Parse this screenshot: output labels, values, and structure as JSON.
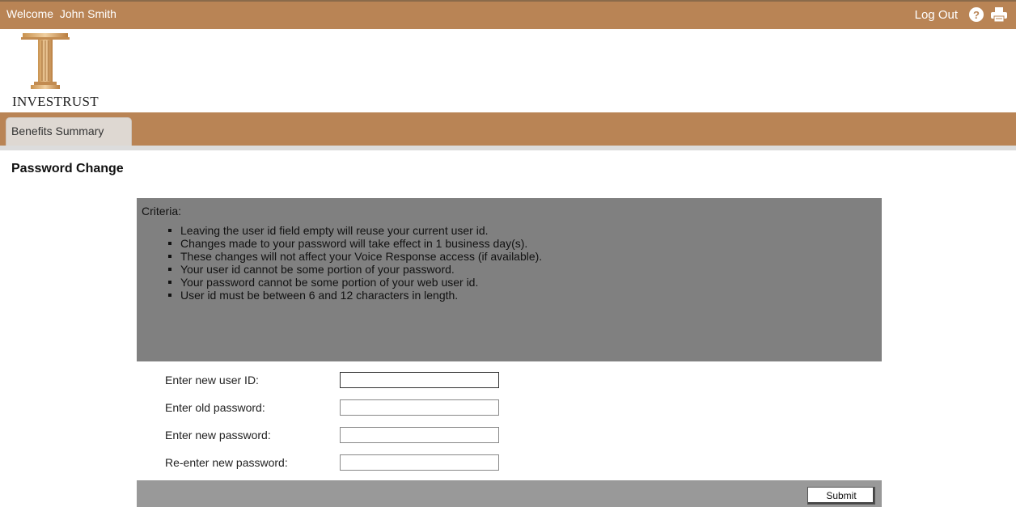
{
  "header": {
    "welcome": "Welcome  John Smith",
    "logout_label": "Log Out",
    "help_icon": "help-icon",
    "print_icon": "print-icon"
  },
  "brand": {
    "name": "INVESTRUST",
    "colors": {
      "header": "#b98455",
      "panel": "#808080",
      "footer": "#999999"
    }
  },
  "nav": {
    "tabs": [
      {
        "label": "Benefits Summary"
      }
    ]
  },
  "page": {
    "title": "Password Change"
  },
  "criteria": {
    "title": "Criteria:",
    "items": [
      "Leaving the user id field empty will reuse your current user id.",
      "Changes made to your password will take effect in 1 business day(s).",
      "These changes will not affect your Voice Response access (if available).",
      "Your user id cannot be some portion of your password.",
      "Your password cannot be some portion of your web user id.",
      "User id must be between 6 and 12 characters in length."
    ]
  },
  "form": {
    "fields": [
      {
        "label": "Enter new user ID:",
        "value": ""
      },
      {
        "label": "Enter old password:",
        "value": ""
      },
      {
        "label": "Enter new password:",
        "value": ""
      },
      {
        "label": "Re-enter new password:",
        "value": ""
      }
    ],
    "submit_label": "Submit"
  }
}
